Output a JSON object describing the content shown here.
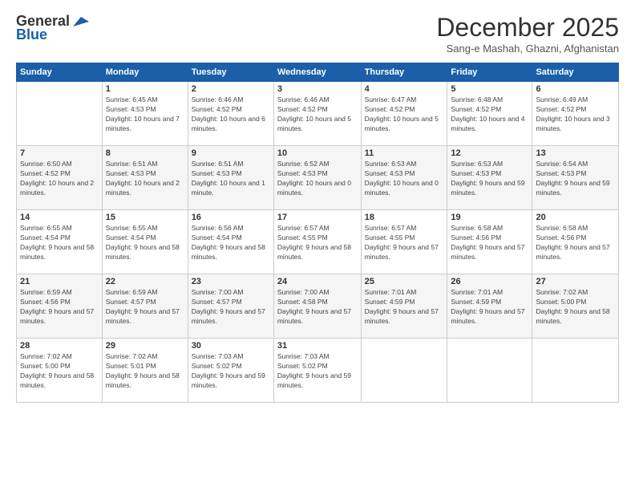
{
  "logo": {
    "general": "General",
    "blue": "Blue"
  },
  "title": "December 2025",
  "location": "Sang-e Mashah, Ghazni, Afghanistan",
  "days_of_week": [
    "Sunday",
    "Monday",
    "Tuesday",
    "Wednesday",
    "Thursday",
    "Friday",
    "Saturday"
  ],
  "weeks": [
    [
      {
        "day": "",
        "sunrise": "",
        "sunset": "",
        "daylight": ""
      },
      {
        "day": "1",
        "sunrise": "Sunrise: 6:45 AM",
        "sunset": "Sunset: 4:53 PM",
        "daylight": "Daylight: 10 hours and 7 minutes."
      },
      {
        "day": "2",
        "sunrise": "Sunrise: 6:46 AM",
        "sunset": "Sunset: 4:52 PM",
        "daylight": "Daylight: 10 hours and 6 minutes."
      },
      {
        "day": "3",
        "sunrise": "Sunrise: 6:46 AM",
        "sunset": "Sunset: 4:52 PM",
        "daylight": "Daylight: 10 hours and 5 minutes."
      },
      {
        "day": "4",
        "sunrise": "Sunrise: 6:47 AM",
        "sunset": "Sunset: 4:52 PM",
        "daylight": "Daylight: 10 hours and 5 minutes."
      },
      {
        "day": "5",
        "sunrise": "Sunrise: 6:48 AM",
        "sunset": "Sunset: 4:52 PM",
        "daylight": "Daylight: 10 hours and 4 minutes."
      },
      {
        "day": "6",
        "sunrise": "Sunrise: 6:49 AM",
        "sunset": "Sunset: 4:52 PM",
        "daylight": "Daylight: 10 hours and 3 minutes."
      }
    ],
    [
      {
        "day": "7",
        "sunrise": "Sunrise: 6:50 AM",
        "sunset": "Sunset: 4:52 PM",
        "daylight": "Daylight: 10 hours and 2 minutes."
      },
      {
        "day": "8",
        "sunrise": "Sunrise: 6:51 AM",
        "sunset": "Sunset: 4:53 PM",
        "daylight": "Daylight: 10 hours and 2 minutes."
      },
      {
        "day": "9",
        "sunrise": "Sunrise: 6:51 AM",
        "sunset": "Sunset: 4:53 PM",
        "daylight": "Daylight: 10 hours and 1 minute."
      },
      {
        "day": "10",
        "sunrise": "Sunrise: 6:52 AM",
        "sunset": "Sunset: 4:53 PM",
        "daylight": "Daylight: 10 hours and 0 minutes."
      },
      {
        "day": "11",
        "sunrise": "Sunrise: 6:53 AM",
        "sunset": "Sunset: 4:53 PM",
        "daylight": "Daylight: 10 hours and 0 minutes."
      },
      {
        "day": "12",
        "sunrise": "Sunrise: 6:53 AM",
        "sunset": "Sunset: 4:53 PM",
        "daylight": "Daylight: 9 hours and 59 minutes."
      },
      {
        "day": "13",
        "sunrise": "Sunrise: 6:54 AM",
        "sunset": "Sunset: 4:53 PM",
        "daylight": "Daylight: 9 hours and 59 minutes."
      }
    ],
    [
      {
        "day": "14",
        "sunrise": "Sunrise: 6:55 AM",
        "sunset": "Sunset: 4:54 PM",
        "daylight": "Daylight: 9 hours and 58 minutes."
      },
      {
        "day": "15",
        "sunrise": "Sunrise: 6:55 AM",
        "sunset": "Sunset: 4:54 PM",
        "daylight": "Daylight: 9 hours and 58 minutes."
      },
      {
        "day": "16",
        "sunrise": "Sunrise: 6:56 AM",
        "sunset": "Sunset: 4:54 PM",
        "daylight": "Daylight: 9 hours and 58 minutes."
      },
      {
        "day": "17",
        "sunrise": "Sunrise: 6:57 AM",
        "sunset": "Sunset: 4:55 PM",
        "daylight": "Daylight: 9 hours and 58 minutes."
      },
      {
        "day": "18",
        "sunrise": "Sunrise: 6:57 AM",
        "sunset": "Sunset: 4:55 PM",
        "daylight": "Daylight: 9 hours and 57 minutes."
      },
      {
        "day": "19",
        "sunrise": "Sunrise: 6:58 AM",
        "sunset": "Sunset: 4:56 PM",
        "daylight": "Daylight: 9 hours and 57 minutes."
      },
      {
        "day": "20",
        "sunrise": "Sunrise: 6:58 AM",
        "sunset": "Sunset: 4:56 PM",
        "daylight": "Daylight: 9 hours and 57 minutes."
      }
    ],
    [
      {
        "day": "21",
        "sunrise": "Sunrise: 6:59 AM",
        "sunset": "Sunset: 4:56 PM",
        "daylight": "Daylight: 9 hours and 57 minutes."
      },
      {
        "day": "22",
        "sunrise": "Sunrise: 6:59 AM",
        "sunset": "Sunset: 4:57 PM",
        "daylight": "Daylight: 9 hours and 57 minutes."
      },
      {
        "day": "23",
        "sunrise": "Sunrise: 7:00 AM",
        "sunset": "Sunset: 4:57 PM",
        "daylight": "Daylight: 9 hours and 57 minutes."
      },
      {
        "day": "24",
        "sunrise": "Sunrise: 7:00 AM",
        "sunset": "Sunset: 4:58 PM",
        "daylight": "Daylight: 9 hours and 57 minutes."
      },
      {
        "day": "25",
        "sunrise": "Sunrise: 7:01 AM",
        "sunset": "Sunset: 4:59 PM",
        "daylight": "Daylight: 9 hours and 57 minutes."
      },
      {
        "day": "26",
        "sunrise": "Sunrise: 7:01 AM",
        "sunset": "Sunset: 4:59 PM",
        "daylight": "Daylight: 9 hours and 57 minutes."
      },
      {
        "day": "27",
        "sunrise": "Sunrise: 7:02 AM",
        "sunset": "Sunset: 5:00 PM",
        "daylight": "Daylight: 9 hours and 58 minutes."
      }
    ],
    [
      {
        "day": "28",
        "sunrise": "Sunrise: 7:02 AM",
        "sunset": "Sunset: 5:00 PM",
        "daylight": "Daylight: 9 hours and 58 minutes."
      },
      {
        "day": "29",
        "sunrise": "Sunrise: 7:02 AM",
        "sunset": "Sunset: 5:01 PM",
        "daylight": "Daylight: 9 hours and 58 minutes."
      },
      {
        "day": "30",
        "sunrise": "Sunrise: 7:03 AM",
        "sunset": "Sunset: 5:02 PM",
        "daylight": "Daylight: 9 hours and 59 minutes."
      },
      {
        "day": "31",
        "sunrise": "Sunrise: 7:03 AM",
        "sunset": "Sunset: 5:02 PM",
        "daylight": "Daylight: 9 hours and 59 minutes."
      },
      {
        "day": "",
        "sunrise": "",
        "sunset": "",
        "daylight": ""
      },
      {
        "day": "",
        "sunrise": "",
        "sunset": "",
        "daylight": ""
      },
      {
        "day": "",
        "sunrise": "",
        "sunset": "",
        "daylight": ""
      }
    ]
  ]
}
